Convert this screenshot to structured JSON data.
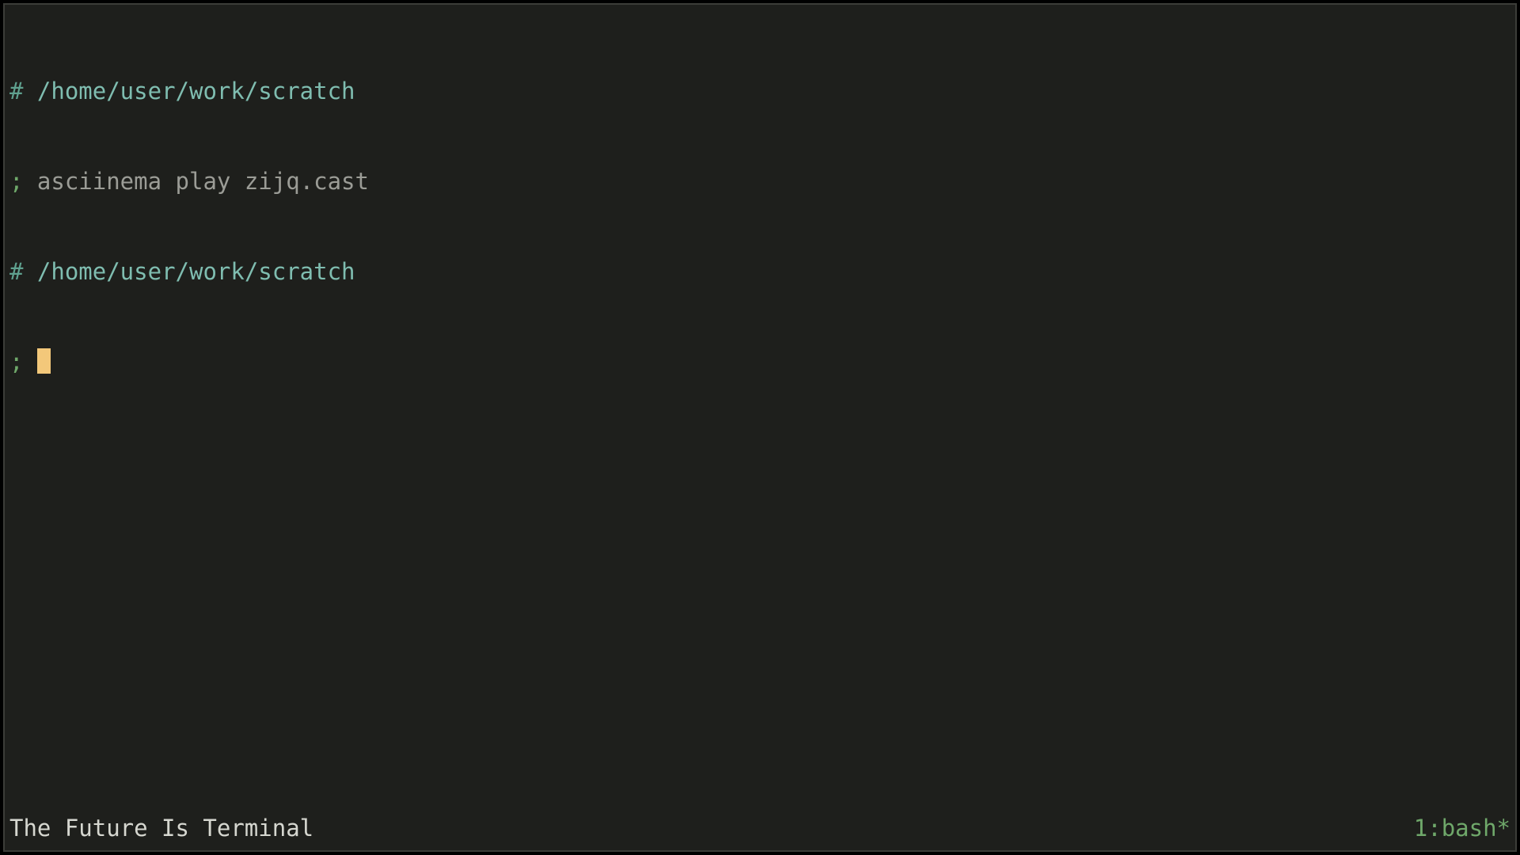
{
  "lines": [
    {
      "hash": "#",
      "path": " /home/user/work/scratch"
    },
    {
      "semi": ";",
      "cmd": " asciinema play zijq.cast"
    },
    {
      "hash": "#",
      "path": " /home/user/work/scratch"
    },
    {
      "semi": ";",
      "cmd": " ",
      "cursor": true
    }
  ],
  "status": {
    "left": "The Future Is Terminal",
    "right": "1:bash*"
  }
}
